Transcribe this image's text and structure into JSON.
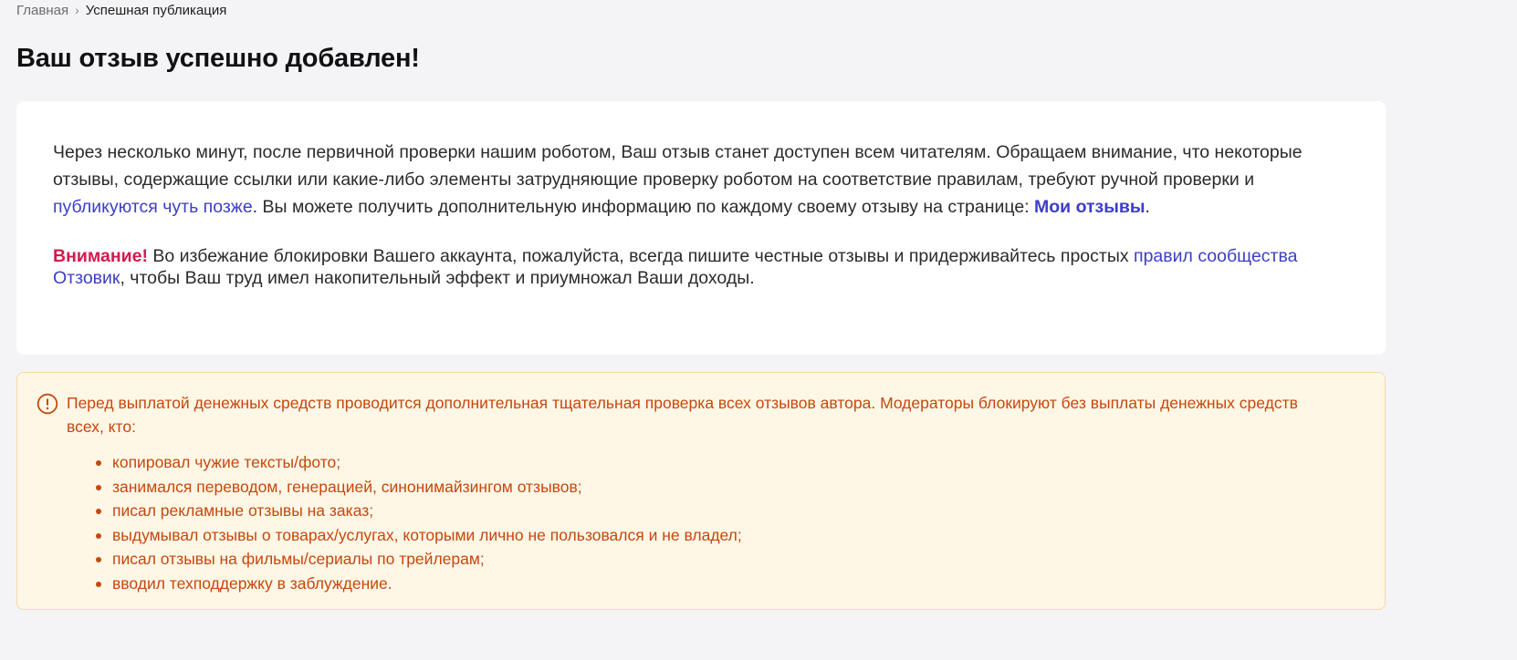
{
  "breadcrumb": {
    "home": "Главная",
    "separator": "›",
    "current": "Успешная публикация"
  },
  "page": {
    "title": "Ваш отзыв успешно добавлен!"
  },
  "card": {
    "info_text_1": "Через несколько минут, после первичной проверки нашим роботом, Ваш отзыв станет доступен всем читателям. Обращаем внимание, что некоторые отзывы, содержащие ссылки или какие-либо элементы затрудняющие проверку роботом на соответствие правилам, требуют ручной проверки и ",
    "info_link_later": "публикуются чуть позже",
    "info_text_2": ". Вы можете получить дополнительную информацию по каждому своему отзыву на странице: ",
    "my_reviews_link": "Мои отзывы",
    "info_text_3": ".",
    "attention_label": "Внимание!",
    "warning_text_1": " Во избежание блокировки Вашего аккаунта, пожалуйста, всегда пишите честные отзывы и придерживайтесь простых ",
    "rules_link": "правил сообщества Отзовик",
    "warning_text_2": ", чтобы Ваш труд имел накопительный эффект и приумножал Ваши доходы."
  },
  "notice": {
    "icon": "exclamation-circle-icon",
    "text": "Перед выплатой денежных средств проводится дополнительная тщательная проверка всех отзывов автора. Модераторы блокируют без выплаты денежных средств всех, кто:",
    "items": [
      "копировал чужие тексты/фото;",
      "занимался переводом, генерацией, синонимайзингом отзывов;",
      "писал рекламные отзывы на заказ;",
      "выдумывал отзывы о товарах/услугах, которыми лично не пользовался и не владел;",
      "писал отзывы на фильмы/сериалы по трейлерам;",
      "вводил техподдержку в заблуждение."
    ]
  },
  "colors": {
    "page_background": "#f4f4f7",
    "link": "#3d3ec7",
    "attention": "#d3194f",
    "notice_text": "#c6470d",
    "notice_background": "#fff7e6",
    "notice_border": "#f3d9a9"
  }
}
